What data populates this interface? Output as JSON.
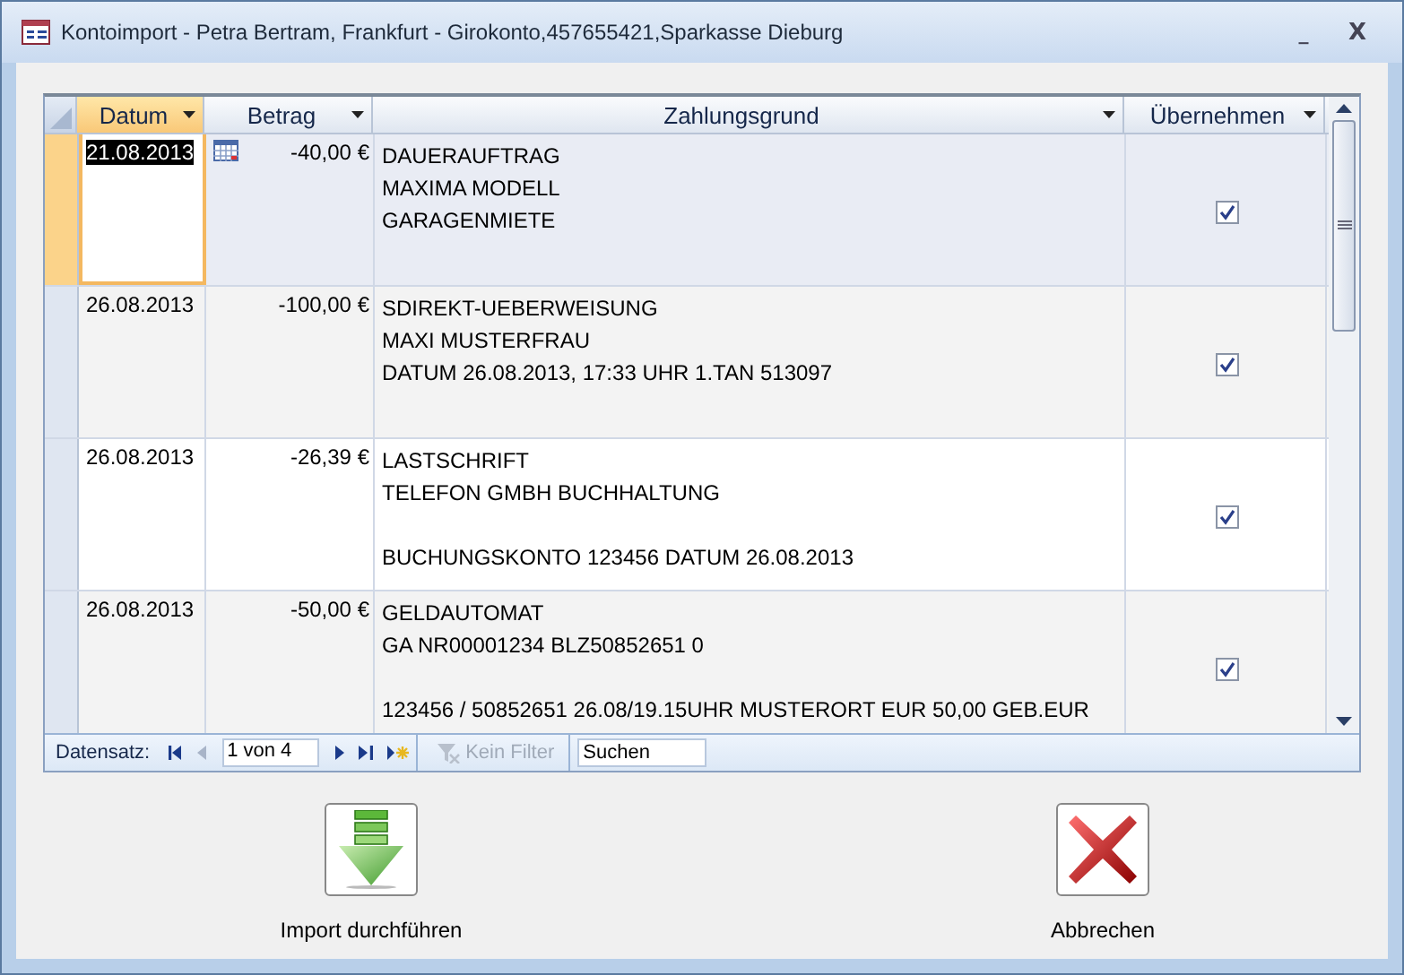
{
  "window": {
    "title": "Kontoimport - Petra Bertram, Frankfurt - Girokonto,457655421,Sparkasse Dieburg",
    "controls": [
      "_",
      "X"
    ]
  },
  "table": {
    "columns": [
      {
        "label": "Datum",
        "active": true
      },
      {
        "label": "Betrag",
        "active": false
      },
      {
        "label": "Zahlungsgrund",
        "active": false
      },
      {
        "label": "Übernehmen",
        "active": false
      }
    ],
    "rows": [
      {
        "selected": true,
        "date": "21.08.2013",
        "amount": "-40,00 €",
        "reason": [
          [
            "DAUERAUFTRAG",
            "MAXIMA MODELL",
            "GARAGENMIETE"
          ]
        ],
        "take": true
      },
      {
        "selected": false,
        "date": "26.08.2013",
        "amount": "-100,00 €",
        "reason": [
          [
            "SDIREKT-UEBERWEISUNG",
            "MAXI MUSTERFRAU",
            "DATUM 26.08.2013, 17:33 UHR 1.TAN 513097"
          ]
        ],
        "take": true
      },
      {
        "selected": false,
        "date": "26.08.2013",
        "amount": "-26,39 €",
        "reason": [
          [
            "LASTSCHRIFT",
            "TELEFON GMBH BUCHHALTUNG"
          ],
          [
            "BUCHUNGSKONTO 123456 DATUM 26.08.2013"
          ]
        ],
        "take": true
      },
      {
        "selected": false,
        "date": "26.08.2013",
        "amount": "-50,00 €",
        "reason": [
          [
            "GELDAUTOMAT",
            "GA NR00001234 BLZ50852651 0"
          ],
          [
            "123456 / 50852651 26.08/19.15UHR MUSTERORT EUR 50,00 GEB.EUR"
          ]
        ],
        "take": true
      }
    ]
  },
  "navigation": {
    "label": "Datensatz:",
    "position": "1 von 4",
    "filter": {
      "label": "Kein Filter",
      "disabled": true
    },
    "search": "Suchen"
  },
  "buttons": [
    {
      "kind": "import",
      "label": "Import durchführen"
    },
    {
      "kind": "cancel",
      "label": "Abbrechen"
    }
  ]
}
